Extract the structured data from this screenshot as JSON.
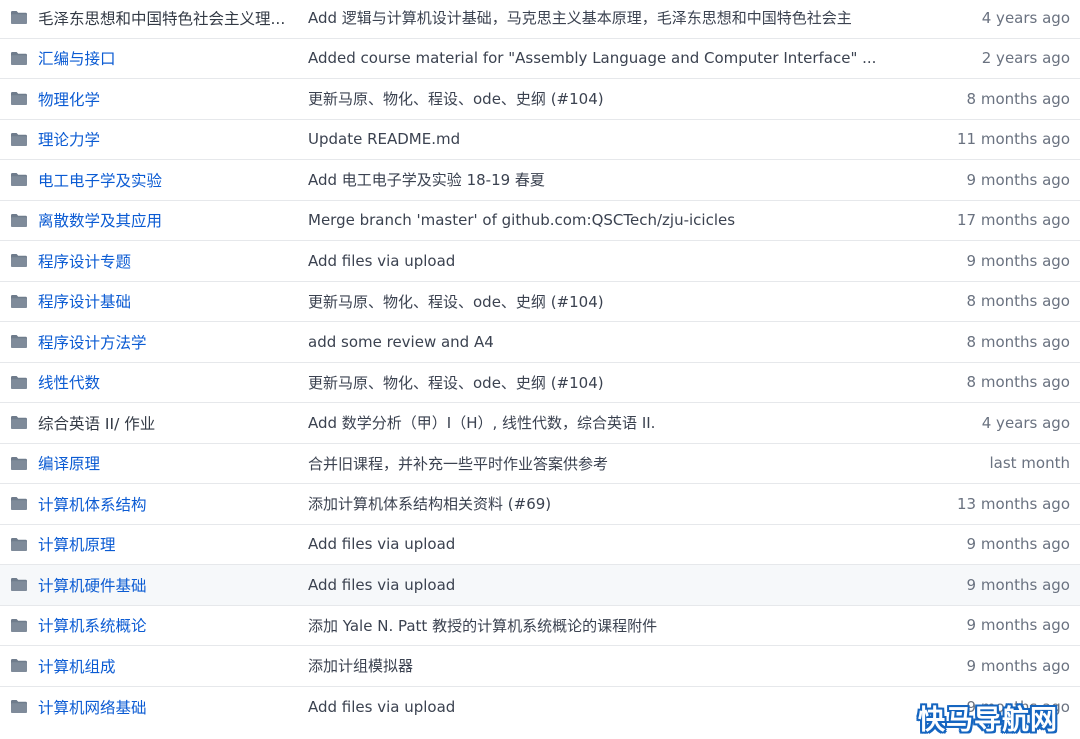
{
  "colors": {
    "link": "#0b5bd3",
    "folder_icon": "#79b8ff",
    "message": "#3b4250",
    "age": "#6a7280",
    "border": "#e6e8eb",
    "highlight_row": "#f6f8fa",
    "watermark_outline": "#1565c0"
  },
  "rows": [
    {
      "name": "毛泽东思想和中国特色社会主义理...",
      "message": "Add 逻辑与计算机设计基础，马克思主义基本原理，毛泽东思想和中国特色社会主",
      "age": "4 years ago",
      "icon": "folder-icon"
    },
    {
      "name": "汇编与接口",
      "message": "Added course material for \"Assembly Language and Computer Interface\" ...",
      "age": "2 years ago",
      "icon": "folder-icon"
    },
    {
      "name": "物理化学",
      "message": "更新马原、物化、程设、ode、史纲 (#104)",
      "age": "8 months ago",
      "icon": "folder-icon"
    },
    {
      "name": "理论力学",
      "message": "Update README.md",
      "age": "11 months ago",
      "icon": "folder-icon"
    },
    {
      "name": "电工电子学及实验",
      "message": "Add 电工电子学及实验 18-19 春夏",
      "age": "9 months ago",
      "icon": "folder-icon"
    },
    {
      "name": "离散数学及其应用",
      "message": "Merge branch 'master' of github.com:QSCTech/zju-icicles",
      "age": "17 months ago",
      "icon": "folder-icon"
    },
    {
      "name": "程序设计专题",
      "message": "Add files via upload",
      "age": "9 months ago",
      "icon": "folder-icon"
    },
    {
      "name": "程序设计基础",
      "message": "更新马原、物化、程设、ode、史纲 (#104)",
      "age": "8 months ago",
      "icon": "folder-icon"
    },
    {
      "name": "程序设计方法学",
      "message": "add some review and A4",
      "age": "8 months ago",
      "icon": "folder-icon"
    },
    {
      "name": "线性代数",
      "message": "更新马原、物化、程设、ode、史纲 (#104)",
      "age": "8 months ago",
      "icon": "folder-icon"
    },
    {
      "name": "综合英语 II/ 作业",
      "message": "Add 数学分析（甲）I（H）, 线性代数，综合英语 II.",
      "age": "4 years ago",
      "icon": "folder-icon"
    },
    {
      "name": "编译原理",
      "message": "合并旧课程，并补充一些平时作业答案供参考",
      "age": "last month",
      "icon": "folder-icon"
    },
    {
      "name": "计算机体系结构",
      "message": "添加计算机体系结构相关资料 (#69)",
      "age": "13 months ago",
      "icon": "folder-icon"
    },
    {
      "name": "计算机原理",
      "message": "Add files via upload",
      "age": "9 months ago",
      "icon": "folder-icon"
    },
    {
      "name": "计算机硬件基础",
      "message": "Add files via upload",
      "age": "9 months ago",
      "icon": "folder-icon",
      "highlighted": true
    },
    {
      "name": "计算机系统概论",
      "message": "添加 Yale N. Patt 教授的计算机系统概论的课程附件",
      "age": "9 months ago",
      "icon": "folder-icon"
    },
    {
      "name": "计算机组成",
      "message": "添加计组模拟器",
      "age": "9 months ago",
      "icon": "folder-icon"
    },
    {
      "name": "计算机网络基础",
      "message": "Add files via upload",
      "age": "9 months ago",
      "icon": "folder-icon"
    }
  ],
  "watermark": {
    "text": "快马导航网"
  }
}
